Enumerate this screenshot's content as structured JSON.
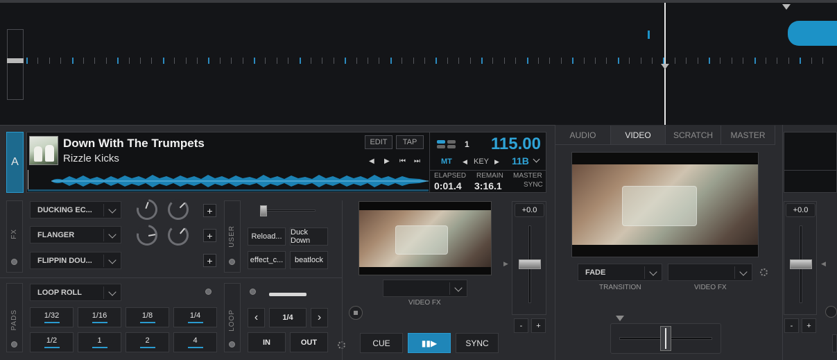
{
  "deck": {
    "letter": "A",
    "track_title": "Down With The Trumpets",
    "artist": "Rizzle Kicks",
    "edit_label": "EDIT",
    "tap_label": "TAP",
    "deck_num": "1",
    "bpm": "115.00",
    "mt_label": "MT",
    "key_label": "KEY",
    "key_value": "11B",
    "elapsed_label": "ELAPSED",
    "elapsed_value": "0:01.4",
    "remain_label": "REMAIN",
    "remain_value": "3:16.1",
    "master_label": "MASTER",
    "sync_label": "SYNC"
  },
  "fx": {
    "side_label": "FX",
    "effects": [
      "DUCKING EC...",
      "FLANGER",
      "FLIPPIN DOU..."
    ],
    "plus": "+"
  },
  "user": {
    "side_label": "USER",
    "buttons": [
      "Reload...",
      "Duck Down",
      "effect_c...",
      "beatlock"
    ]
  },
  "pads": {
    "side_label": "PADS",
    "mode": "LOOP ROLL",
    "values": [
      "1/32",
      "1/16",
      "1/8",
      "1/4",
      "1/2",
      "1",
      "2",
      "4"
    ]
  },
  "loop": {
    "side_label": "LOOP",
    "size": "1/4",
    "in_label": "IN",
    "out_label": "OUT",
    "prev": "‹",
    "next": "›"
  },
  "transport": {
    "cue": "CUE",
    "play": "▮▮▶",
    "sync": "SYNC"
  },
  "video_fx_label": "VIDEO FX",
  "pitch": {
    "left_value": "+0.0",
    "right_value": "+0.0",
    "minus": "-",
    "plus": "+"
  },
  "rtabs": [
    "AUDIO",
    "VIDEO",
    "SCRATCH",
    "MASTER"
  ],
  "rtab_active": "VIDEO",
  "transition": {
    "value": "FADE",
    "label": "TRANSITION",
    "video_fx_label": "VIDEO FX"
  },
  "colors": {
    "accent": "#2fa3d6",
    "deck_blue": "#1d6a8e",
    "waveform": "#1c92c7"
  }
}
